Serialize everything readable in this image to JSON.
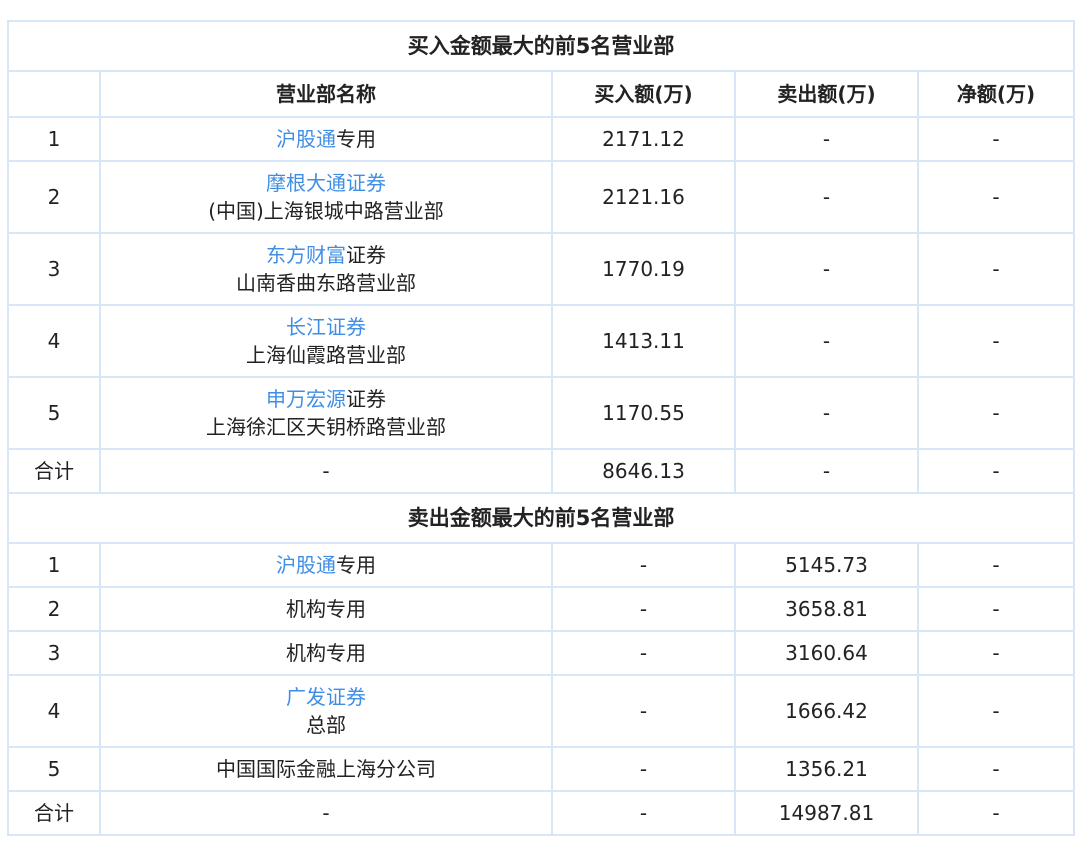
{
  "buy_section": {
    "title": "买入金额最大的前5名营业部",
    "headers": [
      "",
      "营业部名称",
      "买入额(万)",
      "卖出额(万)",
      "净额(万)"
    ],
    "rows": [
      {
        "idx": "1",
        "name_link": "沪股通",
        "name_rest": "专用",
        "name_line2": "",
        "buy": "2171.12",
        "sell": "-",
        "net": "-"
      },
      {
        "idx": "2",
        "name_link": "摩根大通证券",
        "name_rest": "",
        "name_line2": "(中国)上海银城中路营业部",
        "buy": "2121.16",
        "sell": "-",
        "net": "-"
      },
      {
        "idx": "3",
        "name_link": "东方财富",
        "name_rest": "证券",
        "name_line2": "山南香曲东路营业部",
        "buy": "1770.19",
        "sell": "-",
        "net": "-"
      },
      {
        "idx": "4",
        "name_link": "长江证券",
        "name_rest": "",
        "name_line2": "上海仙霞路营业部",
        "buy": "1413.11",
        "sell": "-",
        "net": "-"
      },
      {
        "idx": "5",
        "name_link": "申万宏源",
        "name_rest": "证券",
        "name_line2": "上海徐汇区天钥桥路营业部",
        "buy": "1170.55",
        "sell": "-",
        "net": "-"
      }
    ],
    "total": {
      "idx": "合计",
      "name": "-",
      "buy": "8646.13",
      "sell": "-",
      "net": "-"
    }
  },
  "sell_section": {
    "title": "卖出金额最大的前5名营业部",
    "rows": [
      {
        "idx": "1",
        "name_link": "沪股通",
        "name_rest": "专用",
        "name_line2": "",
        "buy": "-",
        "sell": "5145.73",
        "net": "-"
      },
      {
        "idx": "2",
        "name_link": "",
        "name_rest": "机构专用",
        "name_line2": "",
        "buy": "-",
        "sell": "3658.81",
        "net": "-"
      },
      {
        "idx": "3",
        "name_link": "",
        "name_rest": "机构专用",
        "name_line2": "",
        "buy": "-",
        "sell": "3160.64",
        "net": "-"
      },
      {
        "idx": "4",
        "name_link": "广发证券",
        "name_rest": "",
        "name_line2": "总部",
        "buy": "-",
        "sell": "1666.42",
        "net": "-"
      },
      {
        "idx": "5",
        "name_link": "",
        "name_rest": "中国国际金融上海分公司",
        "name_line2": "",
        "buy": "-",
        "sell": "1356.21",
        "net": "-"
      }
    ],
    "total": {
      "idx": "合计",
      "name": "-",
      "buy": "-",
      "sell": "14987.81",
      "net": "-"
    }
  },
  "colors": {
    "border": "#d7e7f7",
    "link": "#3f8ee6",
    "text": "#222222"
  }
}
